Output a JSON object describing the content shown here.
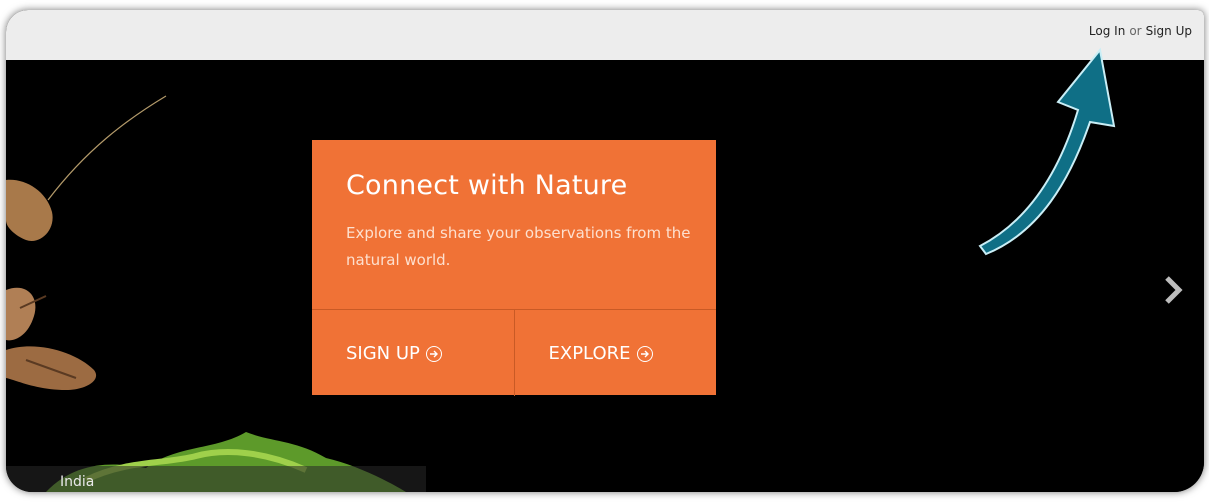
{
  "header": {
    "login_label": "Log In",
    "or_label": "or",
    "signup_label": "Sign Up"
  },
  "hero": {
    "title": "Connect with Nature",
    "subtitle": "Explore and share your observations from the natural world.",
    "signup_button": "SIGN UP",
    "explore_button": "EXPLORE",
    "photo_caption": "India"
  },
  "colors": {
    "card": "#f07236",
    "annotation_arrow": "#0f6f86",
    "topbar": "#ededed"
  },
  "icons": [
    "arrow-circle-right-icon",
    "chevron-right-icon",
    "annotation-arrow-icon"
  ]
}
